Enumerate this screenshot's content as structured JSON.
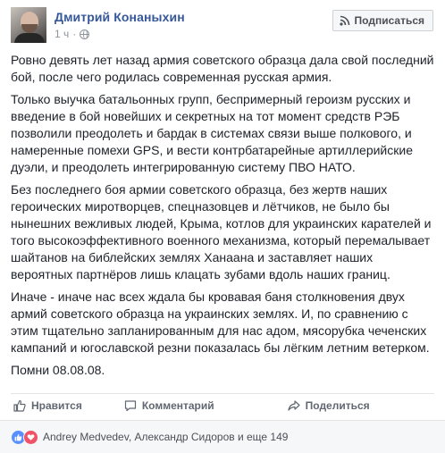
{
  "post": {
    "author": "Дмитрий Конаныхин",
    "time": "1 ч",
    "separator": "·",
    "subscribe_label": "Подписаться",
    "paragraphs": [
      "Ровно девять лет назад армия советского образца дала свой последний бой, после чего родилась современная русская армия.",
      "Только выучка батальонных групп, беспримерный героизм русских и введение в бой новейших и секретных на тот момент средств РЭБ позволили преодолеть и бардак в системах связи выше полкового, и намеренные помехи GPS, и вести контрбатарейные артиллерийские дуэли, и преодолеть интегрированную систему ПВО НАТО.",
      "Без последнего боя армии советского образца, без жертв наших героических миротворцев, спецназовцев и лётчиков, не было бы нынешних вежливых людей, Крыма, котлов для украинских карателей и того высокоэффективного военного механизма, который перемалывает шайтанов на библейских землях Ханаана и заставляет наших вероятных партнёров лишь клацать зубами вдоль наших границ.",
      "Иначе - иначе нас всех ждала бы кровавая баня столкновения двух армий советского образца на украинских землях. И, по сравнению с этим тщательно запланированным для нас адом, мясорубка чеченских кампаний и югославской резни показалась бы лёгким летним ветерком.",
      "Помни 08.08.08."
    ]
  },
  "actions": {
    "like_label": "Нравится",
    "comment_label": "Комментарий",
    "share_label": "Поделиться"
  },
  "reactions": {
    "summary": "Andrey Medvedev, Александр Сидоров и еще 149",
    "icons": [
      "like-icon",
      "love-icon"
    ],
    "colors": {
      "like": "#5890ff",
      "love": "#f25268"
    }
  },
  "colors": {
    "author_link": "#365899",
    "meta_text": "#90949c",
    "body_text": "#1d2129",
    "action_text": "#606770"
  }
}
